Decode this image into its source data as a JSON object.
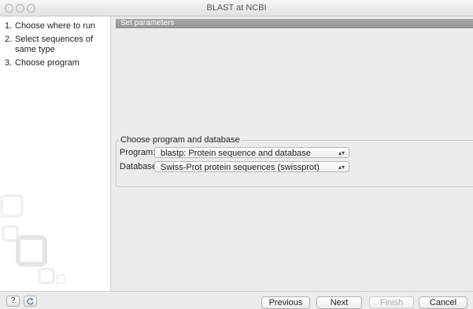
{
  "window": {
    "title": "BLAST at NCBI"
  },
  "sidebar": {
    "steps": [
      {
        "num": "1.",
        "label": "Choose where to run"
      },
      {
        "num": "2.",
        "label": "Select sequences of same type"
      },
      {
        "num": "3.",
        "label": "Choose program"
      }
    ]
  },
  "main": {
    "section_title": "Set parameters",
    "group": {
      "title": "Choose program and database",
      "program_label": "Program:",
      "program_value": "blastp: Protein sequence and database",
      "database_label": "Database",
      "database_value": "Swiss-Prot protein sequences (swissprot)"
    }
  },
  "footer": {
    "help_label": "?",
    "reset_icon": "refresh-icon",
    "previous_label": "Previous",
    "next_label": "Next",
    "finish_label": "Finish",
    "cancel_label": "Cancel"
  }
}
